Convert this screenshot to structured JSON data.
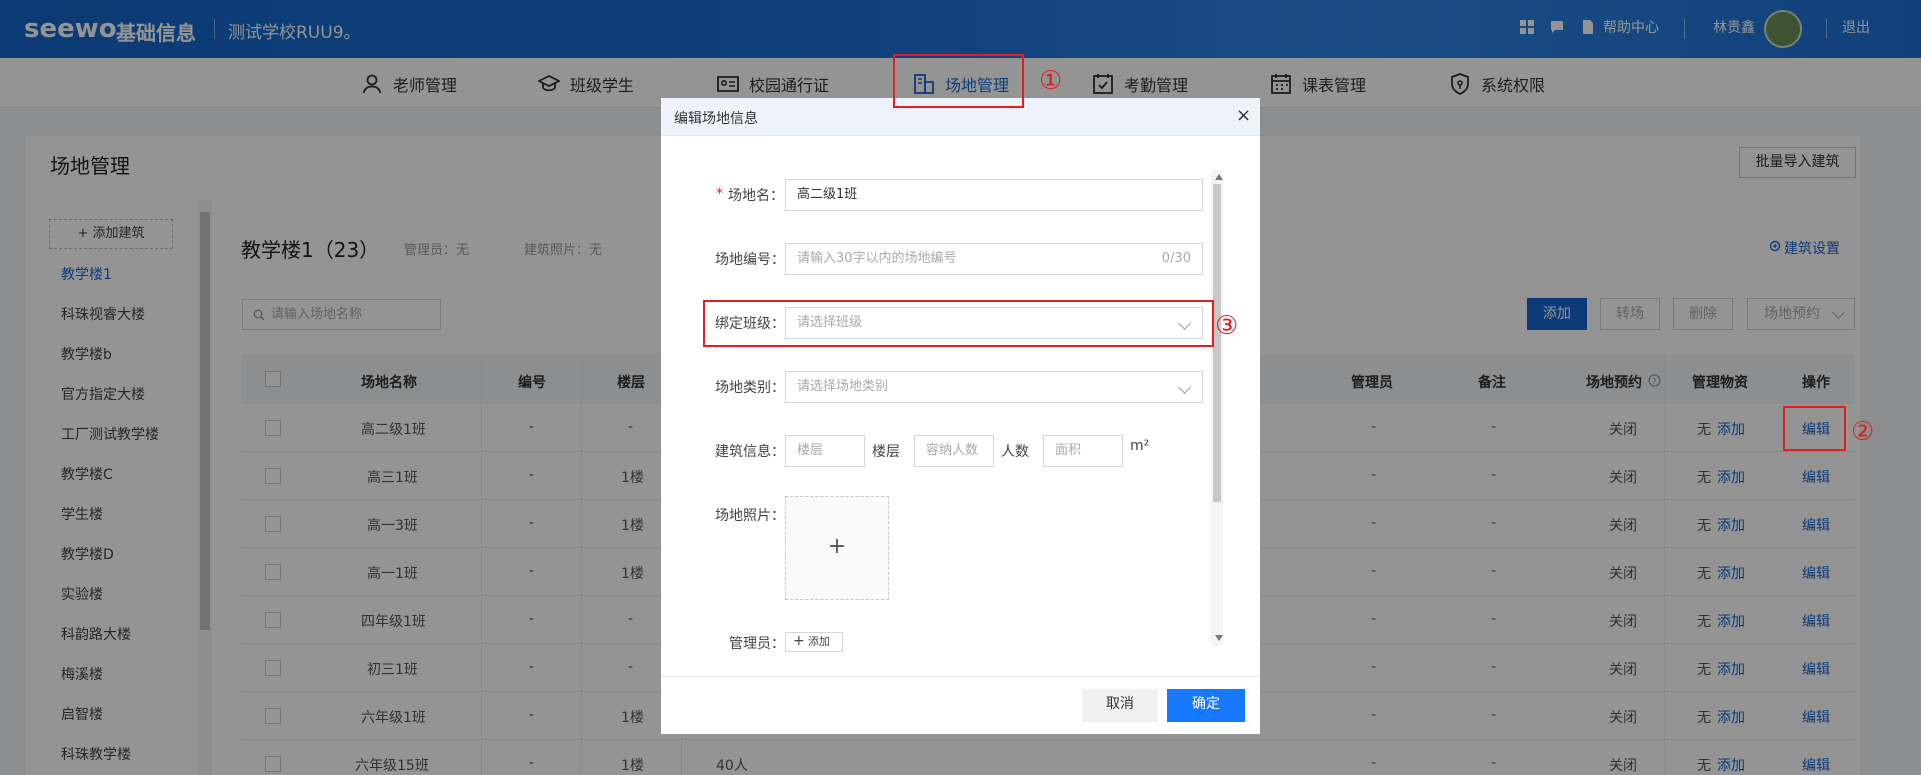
{
  "header": {
    "brand": "seewo",
    "brand_sub": "基础信息",
    "school": "测试学校RUU9。",
    "help": "帮助中心",
    "user": "林贵鑫",
    "logout": "退出"
  },
  "nav": {
    "items": [
      "老师管理",
      "班级学生",
      "校园通行证",
      "场地管理",
      "考勤管理",
      "课表管理",
      "系统权限"
    ]
  },
  "annotations": [
    "①",
    "②",
    "③"
  ],
  "page": {
    "title": "场地管理",
    "import_button": "批量导入建筑"
  },
  "sidebar": {
    "add_button": "+ 添加建筑",
    "items": [
      "教学楼1",
      "科珠视睿大楼",
      "教学楼b",
      "官方指定大楼",
      "工厂测试教学楼",
      "教学楼C",
      "学生楼",
      "教学楼D",
      "实验楼",
      "科韵路大楼",
      "梅溪楼",
      "启智楼",
      "科珠教学楼"
    ]
  },
  "building": {
    "title": "教学楼1（23）",
    "manager": "管理员：无",
    "photo": "建筑照片：无",
    "settings": "建筑设置"
  },
  "toolbar": {
    "search_placeholder": "请输入场地名称",
    "add": "添加",
    "transfer": "转场",
    "delete": "删除",
    "booking": "场地预约"
  },
  "table": {
    "headers": [
      "场地名称",
      "编号",
      "楼层",
      "管理员",
      "备注",
      "场地预约",
      "管理物资",
      "操作"
    ],
    "rows": [
      {
        "name": "高二级1班",
        "code": "-",
        "floor": "-",
        "manager": "-",
        "note": "-",
        "booking": "关闭",
        "supplies": "无",
        "add": "添加",
        "action": "编辑"
      },
      {
        "name": "高三1班",
        "code": "-",
        "floor": "1楼",
        "manager": "-",
        "note": "-",
        "booking": "关闭",
        "supplies": "无",
        "add": "添加",
        "action": "编辑"
      },
      {
        "name": "高一3班",
        "code": "-",
        "floor": "1楼",
        "manager": "-",
        "note": "-",
        "booking": "关闭",
        "supplies": "无",
        "add": "添加",
        "action": "编辑"
      },
      {
        "name": "高一1班",
        "code": "-",
        "floor": "1楼",
        "manager": "-",
        "note": "-",
        "booking": "关闭",
        "supplies": "无",
        "add": "添加",
        "action": "编辑"
      },
      {
        "name": "四年级1班",
        "code": "-",
        "floor": "-",
        "manager": "-",
        "note": "-",
        "booking": "关闭",
        "supplies": "无",
        "add": "添加",
        "action": "编辑"
      },
      {
        "name": "初三1班",
        "code": "-",
        "floor": "-",
        "manager": "-",
        "note": "-",
        "booking": "关闭",
        "supplies": "无",
        "add": "添加",
        "action": "编辑"
      },
      {
        "name": "六年级1班",
        "code": "-",
        "floor": "1楼",
        "manager": "-",
        "note": "-",
        "booking": "关闭",
        "supplies": "无",
        "add": "添加",
        "action": "编辑"
      },
      {
        "name": "六年级15班",
        "code": "-",
        "floor": "1楼",
        "capacity": "40人",
        "manager": "-",
        "note": "-",
        "booking": "关闭",
        "supplies": "无",
        "add": "添加",
        "action": "编辑"
      }
    ]
  },
  "modal": {
    "title": "编辑场地信息",
    "close": "×",
    "name_label": "场地名：",
    "name_required": "*",
    "name_value": "高二级1班",
    "code_label": "场地编号：",
    "code_placeholder": "请输入30字以内的场地编号",
    "code_counter": "0/30",
    "class_label": "绑定班级：",
    "class_placeholder": "请选择班级",
    "type_label": "场地类别：",
    "type_placeholder": "请选择场地类别",
    "building_label": "建筑信息：",
    "floor_placeholder": "楼层",
    "floor_unit": "楼层",
    "capacity_placeholder": "容纳人数",
    "capacity_unit": "人数",
    "area_placeholder": "面积",
    "area_unit": "m²",
    "photo_label": "场地照片：",
    "upload_plus": "+",
    "manager_label": "管理员：",
    "manager_add": "添加",
    "cancel": "取消",
    "confirm": "确定"
  },
  "colors": {
    "primary": "#1867d2",
    "annotation": "#e02020",
    "header": "#1a6fd6"
  }
}
